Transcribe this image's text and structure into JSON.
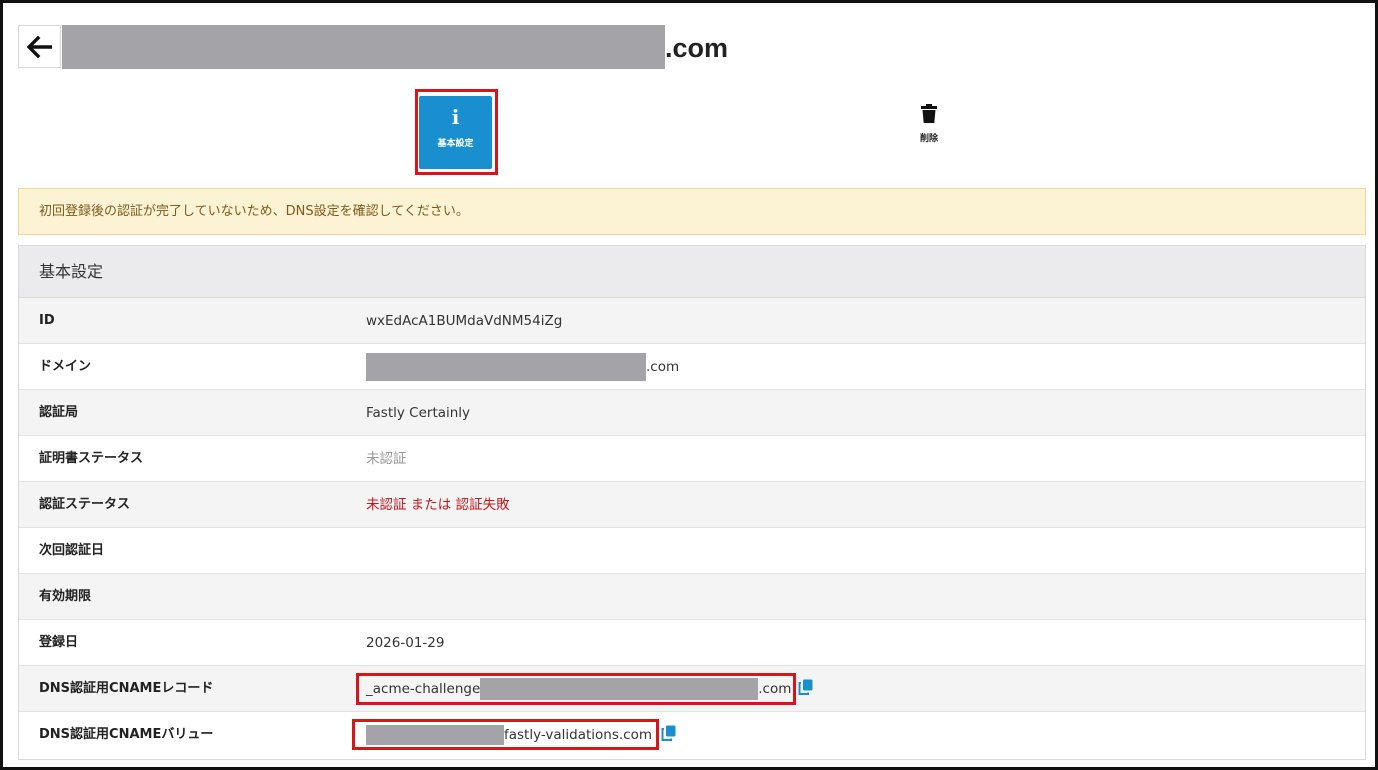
{
  "header": {
    "title_suffix": ".com",
    "back_icon": "arrow-left-icon"
  },
  "tabs": [
    {
      "label": "基本設定",
      "icon": "info-icon",
      "glyph": "i",
      "active": true
    },
    {
      "label": "削除",
      "icon": "trash-icon",
      "active": false
    }
  ],
  "alert": {
    "text": "初回登録後の認証が完了していないため、DNS設定を確認してください。"
  },
  "panel": {
    "title": "基本設定",
    "rows": [
      {
        "key": "ID",
        "value": "wxEdAcA1BUMdaVdNM54iZg"
      },
      {
        "key": "ドメイン",
        "value_suffix": ".com"
      },
      {
        "key": "認証局",
        "value": "Fastly Certainly"
      },
      {
        "key": "証明書ステータス",
        "value": "未認証"
      },
      {
        "key": "認証ステータス",
        "value": "未認証 または 認証失敗"
      },
      {
        "key": "次回認証日",
        "value": ""
      },
      {
        "key": "有効期限",
        "value": ""
      },
      {
        "key": "登録日",
        "value": "2026-01-29"
      },
      {
        "key": "DNS認証用CNAMEレコード",
        "value_prefix": "_acme-challenge",
        "value_suffix": ".com"
      },
      {
        "key": "DNS認証用CNAMEバリュー",
        "value_suffix": "fastly-validations.com"
      }
    ]
  },
  "colors": {
    "accent": "#1a8fd0",
    "highlight_border": "#d9141b",
    "error_text": "#c8161c",
    "alert_bg": "#fcf3d4",
    "redaction": "#a4a4a8"
  }
}
